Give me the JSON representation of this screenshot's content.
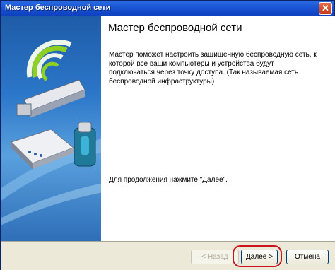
{
  "window": {
    "title": "Мастер беспроводной сети",
    "close_symbol": "✕"
  },
  "main": {
    "heading": "Мастер беспроводной сети",
    "description": "Мастер поможет настроить защищенную беспроводную сеть, к которой все ваши компьютеры и устройства будут подключаться через точку доступа. (Так называемая сеть беспроводной инфраструктуры)",
    "continue_text": "Для продолжения нажмите \"Далее\"."
  },
  "buttons": {
    "back": "< Назад",
    "next": "Далее >",
    "cancel": "Отмена"
  },
  "icons": [
    "wifi-signal-icon",
    "usb-adapter-icon",
    "access-point-icon",
    "flash-drive-icon"
  ],
  "colors": {
    "titlebar": "#1c56d4",
    "highlight": "#c9141c",
    "panel": "#2c77c9",
    "signal": "#8fd021"
  }
}
